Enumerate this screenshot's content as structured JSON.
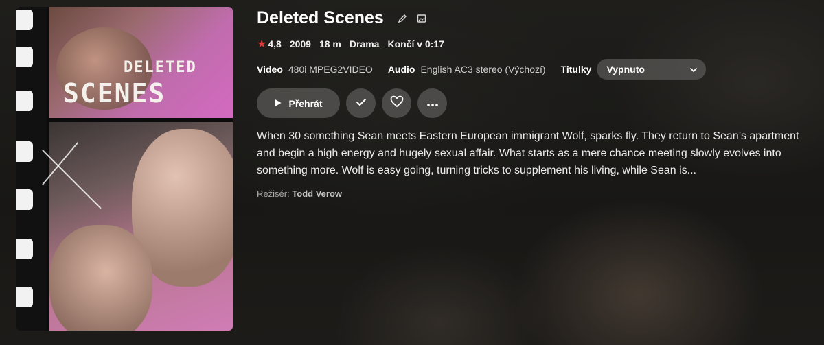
{
  "item": {
    "title": "Deleted Scenes",
    "rating": "4,8",
    "year": "2009",
    "runtime": "18 m",
    "genre": "Drama",
    "ends_at": "Končí v 0:17",
    "poster": {
      "title_line1": "DELETED",
      "title_line2": "SCENES"
    },
    "overview": "When 30 something Sean meets Eastern European immigrant Wolf, sparks fly. They return to Sean’s apartment and begin a high energy and hugely sexual affair. What starts as a mere chance meeting slowly evolves into something more. Wolf is easy going, turning tricks to supplement his living, while Sean is...",
    "director_label": "Režisér:",
    "director": "Todd Verow"
  },
  "media": {
    "video_label": "Video",
    "video_value": "480i MPEG2VIDEO",
    "audio_label": "Audio",
    "audio_value": "English AC3 stereo (Výchozí)",
    "subtitles_label": "Titulky",
    "subtitles_value": "Vypnuto"
  },
  "actions": {
    "play_label": "Přehrát"
  },
  "icons": {
    "edit": "pencil-icon",
    "image": "image-icon",
    "star": "star-icon",
    "check": "check-icon",
    "heart": "heart-icon",
    "more": "more-icon",
    "play": "play-icon",
    "chevron": "chevron-down-icon"
  },
  "colors": {
    "star": "#e03b3b",
    "button_bg": "#5f5d5b",
    "background": "#201f1c"
  }
}
